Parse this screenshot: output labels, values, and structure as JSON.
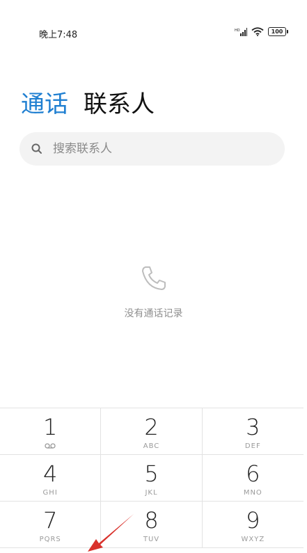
{
  "status": {
    "time": "晚上7:48",
    "battery": "100"
  },
  "tabs": [
    {
      "label": "通话",
      "active": true
    },
    {
      "label": "联系人",
      "active": false
    }
  ],
  "search": {
    "placeholder": "搜索联系人"
  },
  "empty_state": {
    "message": "没有通话记录",
    "icon": "phone-icon"
  },
  "keypad": {
    "keys": [
      {
        "digit": "1",
        "letters": "",
        "icon": "voicemail-icon"
      },
      {
        "digit": "2",
        "letters": "ABC"
      },
      {
        "digit": "3",
        "letters": "DEF"
      },
      {
        "digit": "4",
        "letters": "GHI"
      },
      {
        "digit": "5",
        "letters": "JKL"
      },
      {
        "digit": "6",
        "letters": "MNO"
      },
      {
        "digit": "7",
        "letters": "PQRS"
      },
      {
        "digit": "8",
        "letters": "TUV"
      },
      {
        "digit": "9",
        "letters": "WXYZ"
      }
    ]
  },
  "colors": {
    "accent": "#1f7fd1",
    "annotation": "#d9312b"
  }
}
